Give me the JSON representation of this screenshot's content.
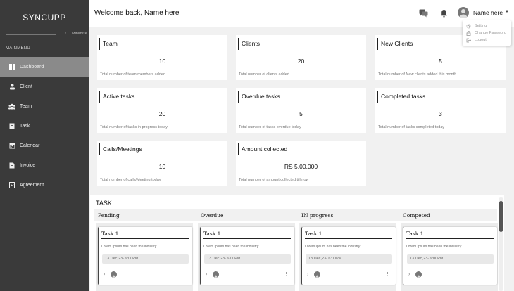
{
  "app": {
    "brand": "SYNCUPP"
  },
  "sidebar": {
    "minimize_label": "Minimize",
    "menu_title": "MAINMENU",
    "items": [
      {
        "label": "Dashboard",
        "icon": "dashboard-icon",
        "active": true
      },
      {
        "label": "Client",
        "icon": "client-icon"
      },
      {
        "label": "Team",
        "icon": "team-icon"
      },
      {
        "label": "Task",
        "icon": "task-icon"
      },
      {
        "label": "Calendar",
        "icon": "calendar-icon"
      },
      {
        "label": "Invoice",
        "icon": "invoice-icon"
      },
      {
        "label": "Agreement",
        "icon": "agreement-icon"
      }
    ]
  },
  "header": {
    "welcome": "Welcome back, Name here",
    "user_name": "Name here"
  },
  "user_menu": {
    "items": [
      {
        "label": "Setting",
        "icon": "gear-icon"
      },
      {
        "label": "Change Password",
        "icon": "lock-icon"
      },
      {
        "label": "Logout",
        "icon": "logout-icon"
      }
    ]
  },
  "stats": [
    {
      "title": "Team",
      "value": "10",
      "desc": "Total number of team members added"
    },
    {
      "title": "Clients",
      "value": "20",
      "desc": "Total number of clients  added"
    },
    {
      "title": "New Clients",
      "value": "5",
      "desc": "Total number of New clients added this month"
    },
    {
      "title": "Active tasks",
      "value": "20",
      "desc": "Total number of tasks in progress today"
    },
    {
      "title": "Overdue tasks",
      "value": "5",
      "desc": "Total number of tasks overdue today"
    },
    {
      "title": "Completed tasks",
      "value": "3",
      "desc": "Total number of tasks completed today"
    },
    {
      "title": "Calls/Meetings",
      "value": "10",
      "desc": "Total number of calls/Meeting today"
    },
    {
      "title": "Amount collected",
      "value": "RS 5,00,000",
      "desc": "Total number of amount collected till now"
    }
  ],
  "tasks": {
    "title": "TASK",
    "columns": [
      {
        "label": "Pending",
        "card": {
          "title": "Task 1",
          "desc": "Lorem Ipsum has been the industry",
          "date": "13 Dec,23- 6:00PM"
        }
      },
      {
        "label": "Overdue",
        "card": {
          "title": "Task 1",
          "desc": "Lorem Ipsum has been the industry",
          "date": "13 Dec,23- 6:00PM"
        }
      },
      {
        "label": "IN progress",
        "card": {
          "title": "Task 1",
          "desc": "Lorem Ipsum has been the industry",
          "date": "13 Dec,23- 6:00PM"
        }
      },
      {
        "label": "Competed",
        "card": {
          "title": "Task 1",
          "desc": "Lorem Ipsum has been the industry",
          "date": "13 Dec,23- 6:00PM"
        }
      }
    ]
  }
}
